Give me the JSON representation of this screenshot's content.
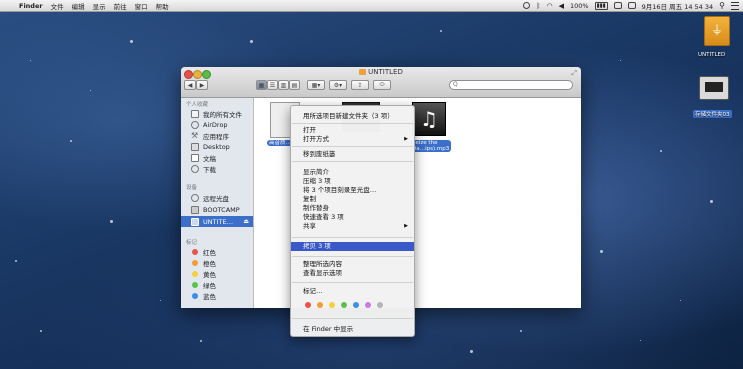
{
  "menubar": {
    "apple_symbol": "",
    "app_name": "Finder",
    "menus": [
      "文件",
      "编辑",
      "显示",
      "前往",
      "窗口",
      "帮助"
    ],
    "battery": "100%",
    "datetime": "9月16日 周五  14 54 34"
  },
  "window": {
    "title": "UNTITLED",
    "toolbar": {
      "back": "◀",
      "forward": "▶",
      "search_placeholder": "Q"
    }
  },
  "sidebar": {
    "sections": [
      {
        "header": "个人收藏",
        "items": [
          {
            "label": "我的所有文件",
            "icon": "all-files-icon"
          },
          {
            "label": "AirDrop",
            "icon": "airdrop-icon"
          },
          {
            "label": "应用程序",
            "icon": "applications-icon"
          },
          {
            "label": "Desktop",
            "icon": "desktop-icon"
          },
          {
            "label": "文稿",
            "icon": "documents-icon"
          },
          {
            "label": "下载",
            "icon": "downloads-icon"
          }
        ]
      },
      {
        "header": "设备",
        "items": [
          {
            "label": "远程光盘",
            "icon": "remote-disc-icon"
          },
          {
            "label": "BOOTCAMP",
            "icon": "drive-icon"
          },
          {
            "label": "UNTITE…",
            "icon": "usb-drive-icon",
            "selected": true
          }
        ]
      },
      {
        "header": "标记",
        "items": [
          {
            "label": "红色",
            "color": "#e8534b"
          },
          {
            "label": "橙色",
            "color": "#f39c30"
          },
          {
            "label": "黄色",
            "color": "#f2d13b"
          },
          {
            "label": "绿色",
            "color": "#5dc24c"
          },
          {
            "label": "蓝色",
            "color": "#3d8ee8"
          }
        ]
      }
    ]
  },
  "files": [
    {
      "label": "高音质…"
    },
    {
      "label": ""
    },
    {
      "label": "Seize the\nDa…ips).mp3"
    }
  ],
  "context_menu": {
    "items": [
      {
        "label": "用所选项目新建文件夹（3 项）"
      },
      {
        "label": "打开"
      },
      {
        "label": "打开方式",
        "submenu": true
      },
      {
        "label": "移到废纸篓"
      },
      {
        "label": "显示简介"
      },
      {
        "label": "压缩 3 项"
      },
      {
        "label": "将 3 个项目刻录至光盘…"
      },
      {
        "label": "复制"
      },
      {
        "label": "制作替身"
      },
      {
        "label": "快速查看 3 项"
      },
      {
        "label": "共享",
        "submenu": true
      },
      {
        "label": "拷贝 3 项",
        "highlighted": true
      },
      {
        "label": "整理所选内容"
      },
      {
        "label": "查看显示选项"
      },
      {
        "label": "标记…"
      },
      {
        "label": "在 Finder 中显示"
      }
    ],
    "tag_colors": [
      "#e8534b",
      "#f39c30",
      "#f2d13b",
      "#5dc24c",
      "#3d8ee8",
      "#c77be0",
      "#b5b5b5"
    ]
  },
  "desktop_icons": [
    {
      "label": "UNTITLED"
    },
    {
      "label": "存储文件夹03"
    }
  ]
}
